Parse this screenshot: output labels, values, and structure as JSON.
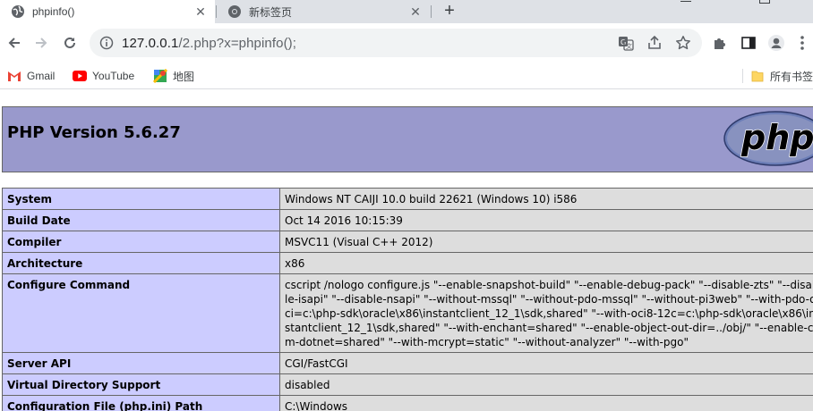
{
  "tabs": [
    {
      "title": "phpinfo()",
      "active": true
    },
    {
      "title": "新标签页",
      "active": false
    }
  ],
  "omnibox": {
    "host": "127.0.0.1",
    "path": "/2.php?x=phpinfo();"
  },
  "bookmarks": [
    {
      "label": "Gmail",
      "icon": "gmail-icon"
    },
    {
      "label": "YouTube",
      "icon": "youtube-icon"
    },
    {
      "label": "地图",
      "icon": "maps-icon"
    }
  ],
  "all_bookmarks_label": "所有书签",
  "php": {
    "version_title": "PHP Version 5.6.27",
    "logo_text": "php",
    "rows": [
      {
        "key": "System",
        "value": "Windows NT CAIJI 10.0 build 22621 (Windows 10) i586"
      },
      {
        "key": "Build Date",
        "value": "Oct 14 2016 10:15:39"
      },
      {
        "key": "Compiler",
        "value": "MSVC11 (Visual C++ 2012)"
      },
      {
        "key": "Architecture",
        "value": "x86"
      },
      {
        "key": "Configure Command",
        "value": "cscript /nologo configure.js \"--enable-snapshot-build\" \"--enable-debug-pack\" \"--disable-zts\" \"--disable-isapi\" \"--disable-nsapi\" \"--without-mssql\" \"--without-pdo-mssql\" \"--without-pi3web\" \"--with-pdo-oci=c:\\php-sdk\\oracle\\x86\\instantclient_12_1\\sdk,shared\" \"--with-oci8-12c=c:\\php-sdk\\oracle\\x86\\instantclient_12_1\\sdk,shared\" \"--with-enchant=shared\" \"--enable-object-out-dir=../obj/\" \"--enable-com-dotnet=shared\" \"--with-mcrypt=static\" \"--without-analyzer\" \"--with-pgo\""
      },
      {
        "key": "Server API",
        "value": "CGI/FastCGI"
      },
      {
        "key": "Virtual Directory Support",
        "value": "disabled"
      },
      {
        "key": "Configuration File (php.ini) Path",
        "value": "C:\\Windows"
      }
    ]
  },
  "colors": {
    "header_bg": "#9999cc",
    "key_bg": "#ccccff",
    "value_bg": "#dddddd",
    "youtube_red": "#ff0000",
    "gmail_red": "#ea4335"
  }
}
